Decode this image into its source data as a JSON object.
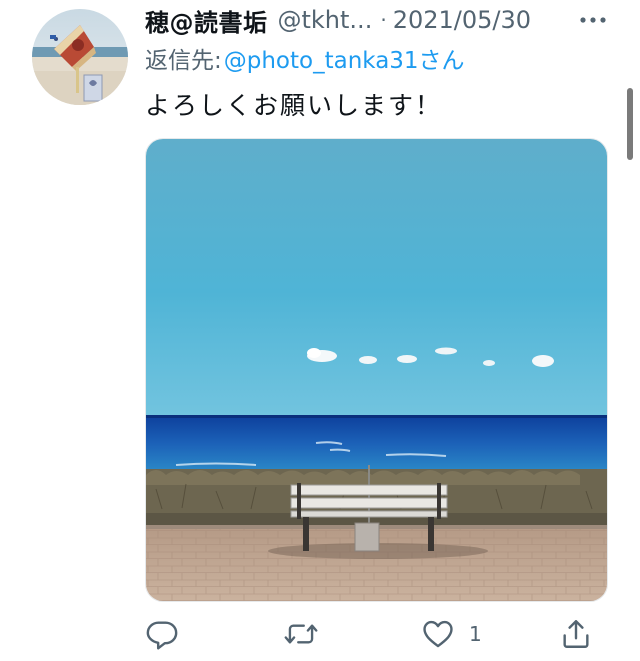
{
  "tweet": {
    "display_name": "穂@読書垢",
    "handle": "@tkht...",
    "separator": "·",
    "date": "2021/05/30",
    "reply_prefix": "返信先: ",
    "reply_target": "@photo_tanka31さん",
    "text": "よろしくお願いします！"
  },
  "actions": {
    "like_count": "1"
  },
  "icons": {
    "more": "more-icon",
    "reply": "reply-icon",
    "retweet": "retweet-icon",
    "like": "heart-icon",
    "share": "share-icon"
  },
  "colors": {
    "link": "#1d9bf0",
    "secondary_text": "#536471",
    "primary_text": "#0f1419"
  }
}
